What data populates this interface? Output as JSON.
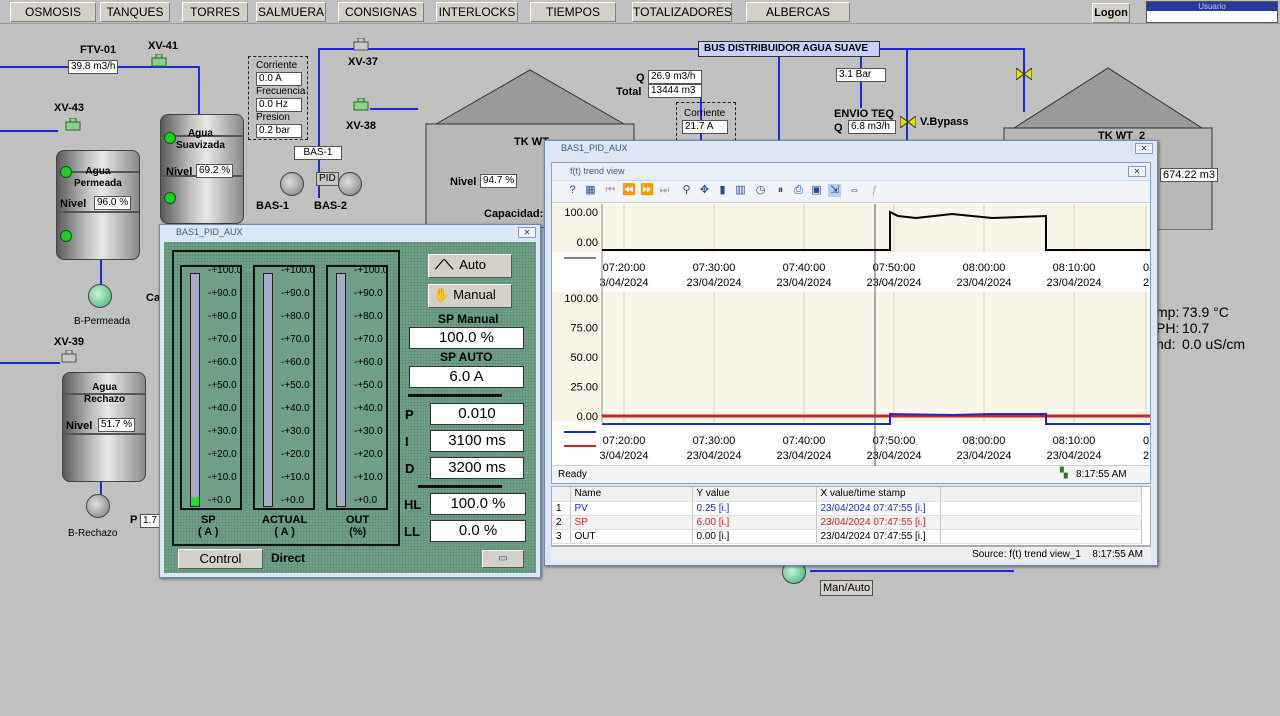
{
  "nav": [
    "OSMOSIS",
    "TANQUES",
    "TORRES",
    "SALMUERA",
    "CONSIGNAS",
    "INTERLOCKS",
    "TIEMPOS",
    "TOTALIZADORES",
    "ALBERCAS"
  ],
  "logon": "Logon",
  "user_label": "Usuario",
  "scada": {
    "ftv01": "FTV-01",
    "ftv01_val": "39.8 m3/h",
    "xv41": "XV-41",
    "xv43": "XV-43",
    "xv37": "XV-37",
    "xv38": "XV-38",
    "xv39": "XV-39",
    "tank_permeada": "Agua\nPermeada",
    "nivel": "Nivel",
    "permeada_val": "96.0 %",
    "tank_suavizada": "Agua\nSuavizada",
    "suavizada_val": "69.2 %",
    "tank_rechazo": "Agua\nRechazo",
    "rechazo_val": "51.7 %",
    "b_permeada": "B-Permeada",
    "b_rechazo": "B-Rechazo",
    "ca": "Ca",
    "corriente": "Corriente",
    "corriente_val": "0.0 A",
    "frecuencia": "Frecuencia",
    "frecuencia_val": "0.0 Hz",
    "presion": "Presion",
    "presion_val": "0.2 bar",
    "bas1_box": "BAS-1",
    "pid": "PID",
    "bas1": "BAS-1",
    "bas2": "BAS-2",
    "bus": "BUS DISTRIBUIDOR AGUA SUAVE",
    "q": "Q",
    "q_val": "26.9 m3/h",
    "total": "Total",
    "total_val": "13444 m3",
    "corriente2_val": "21.7 A",
    "bar_val": "3.1 Bar",
    "envio": "ENVIO TEQ",
    "envio_q": "6.8 m3/h",
    "vbypass": "V.Bypass",
    "tk_wt": "TK WT",
    "tk_wt2": "TK WT_2",
    "tk_nivel_val": "94.7 %",
    "tk_vol_val": "674.22 m3",
    "capacidad": "Capacidad: 7",
    "temp_lbl": "mp:",
    "temp_val": "73.9 °C",
    "ph_lbl": "PH:",
    "ph_val": "10.7",
    "cond_lbl": "nd:",
    "cond_val": "0.0 uS/cm",
    "p_lbl": "P",
    "p_val": "1.7",
    "manauto": "Man/Auto"
  },
  "pid": {
    "title": "BAS1_PID_AUX",
    "ticks": [
      "+100.0",
      "+90.0",
      "+80.0",
      "+70.0",
      "+60.0",
      "+50.0",
      "+40.0",
      "+30.0",
      "+20.0",
      "+10.0",
      "+0.0"
    ],
    "sp_label": "SP\n( A )",
    "actual_label": "ACTUAL\n( A )",
    "out_label": "OUT\n(%)",
    "sp_fill": 0.04,
    "actual_fill": 0.0,
    "out_fill": 0.0,
    "auto_btn": "Auto",
    "manual_btn": "Manual",
    "sp_manual_lbl": "SP Manual",
    "sp_manual_val": "100.0 %",
    "sp_auto_lbl": "SP AUTO",
    "sp_auto_val": "6.0 A",
    "p_lbl": "P",
    "p_val": "0.010",
    "i_lbl": "I",
    "i_val": "3100 ms",
    "d_lbl": "D",
    "d_val": "3200 ms",
    "hl_lbl": "HL",
    "hl_val": "100.0 %",
    "ll_lbl": "LL",
    "ll_val": "0.0 %",
    "control_btn": "Control",
    "direct": "Direct"
  },
  "trend": {
    "title": "BAS1_PID_AUX",
    "inner_title": "f(t) trend view",
    "status": "Ready",
    "time": "8:17:55 AM",
    "top_y": [
      "100.00",
      "0.00"
    ],
    "bottom_y": [
      "100.00",
      "75.00",
      "50.00",
      "25.00",
      "0.00"
    ],
    "x_times": [
      "07:20:00",
      "07:30:00",
      "07:40:00",
      "07:50:00",
      "08:00:00",
      "08:10:00",
      "0"
    ],
    "x_dates": [
      "3/04/2024",
      "23/04/2024",
      "23/04/2024",
      "23/04/2024",
      "23/04/2024",
      "23/04/2024",
      "2"
    ],
    "colors": {
      "pv": "#1a2bd8",
      "sp": "#d42020",
      "out": "#000000"
    },
    "columns": [
      "Name",
      "Y value",
      "X value/time stamp"
    ],
    "rows": [
      {
        "n": "1",
        "name": "PV",
        "y": "0.25 [i.]",
        "x": "23/04/2024 07:47:55 [i.]"
      },
      {
        "n": "2",
        "name": "SP",
        "y": "6.00 [i.]",
        "x": "23/04/2024 07:47:55 [i.]"
      },
      {
        "n": "3",
        "name": "OUT",
        "y": "0.00 [i.]",
        "x": "23/04/2024 07:47:55 [i.]"
      }
    ],
    "source": "Source: f(t) trend view_1",
    "source_time": "8:17:55 AM"
  }
}
